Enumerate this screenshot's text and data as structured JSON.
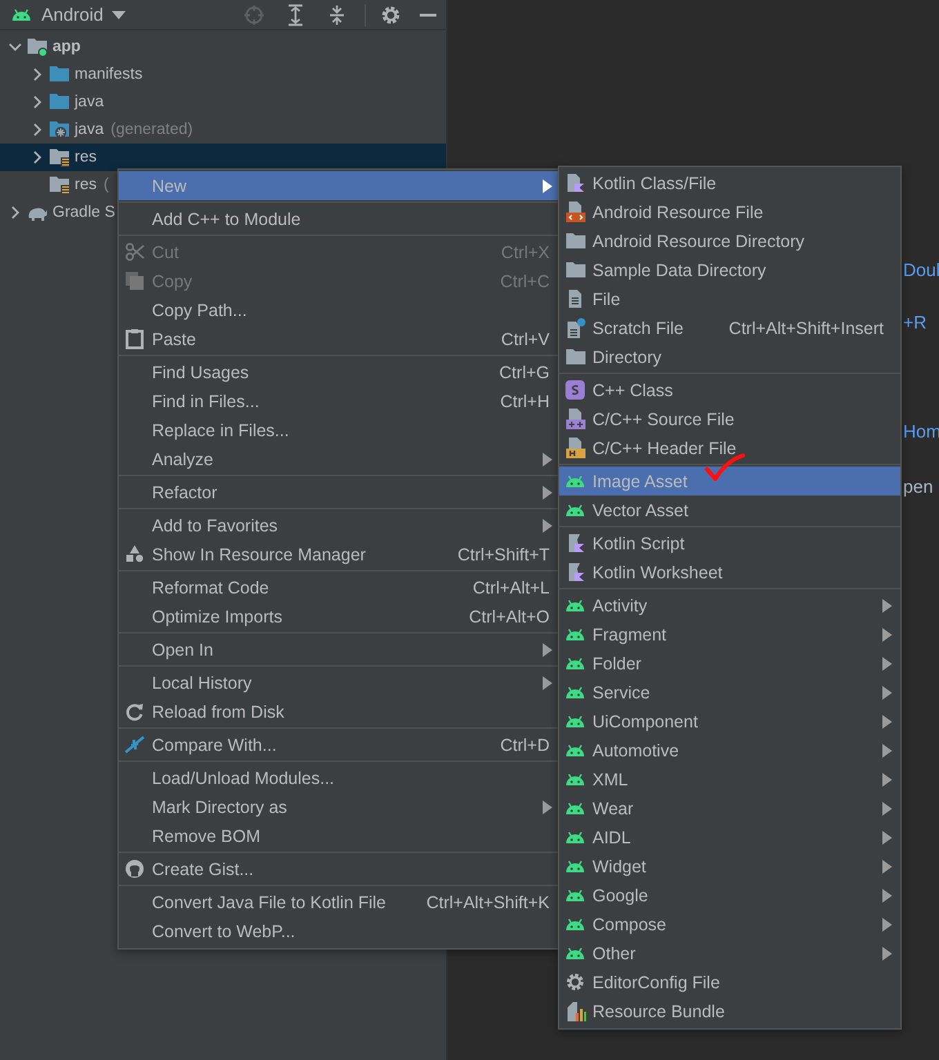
{
  "tool_window": {
    "title": "Android"
  },
  "tree": [
    {
      "label": "app",
      "kind": "module",
      "expanded": true,
      "selected": false,
      "children": [
        {
          "label": "manifests",
          "kind": "folder",
          "expanded": false,
          "selected": false
        },
        {
          "label": "java",
          "kind": "folder",
          "expanded": false,
          "selected": false
        },
        {
          "label": "java",
          "suffix": "(generated)",
          "kind": "generated",
          "expanded": false,
          "selected": false
        },
        {
          "label": "res",
          "kind": "resources",
          "expanded": false,
          "selected": true
        },
        {
          "label": "res",
          "suffix": "(",
          "kind": "resources",
          "selected": false
        }
      ]
    },
    {
      "label": "Gradle S",
      "kind": "gradle",
      "expanded": false,
      "selected": false
    }
  ],
  "editor": {
    "fragments": [
      {
        "text": "Doul",
        "kind": "link"
      },
      {
        "text": "+R",
        "kind": "link"
      },
      {
        "text": "Hom",
        "kind": "link"
      },
      {
        "text": "pen",
        "kind": "text"
      }
    ]
  },
  "context_menu": {
    "groups": [
      [
        {
          "label": "New",
          "kind": "plain",
          "submenu": true,
          "disabled": false,
          "selected": true
        }
      ],
      [
        {
          "label": "Add C++ to Module",
          "kind": "plain",
          "submenu": false,
          "disabled": false,
          "selected": false
        }
      ],
      [
        {
          "label": "Cut",
          "shortcut": "Ctrl+X",
          "kind": "scissors",
          "submenu": false,
          "disabled": true,
          "selected": false
        },
        {
          "label": "Copy",
          "shortcut": "Ctrl+C",
          "kind": "copy",
          "submenu": false,
          "disabled": true,
          "selected": false
        },
        {
          "label": "Copy Path...",
          "kind": "plain",
          "submenu": false,
          "disabled": false,
          "selected": false
        },
        {
          "label": "Paste",
          "shortcut": "Ctrl+V",
          "kind": "clipboard",
          "submenu": false,
          "disabled": false,
          "selected": false
        }
      ],
      [
        {
          "label": "Find Usages",
          "shortcut": "Ctrl+G",
          "kind": "plain",
          "submenu": false,
          "disabled": false,
          "selected": false
        },
        {
          "label": "Find in Files...",
          "shortcut": "Ctrl+H",
          "kind": "plain",
          "submenu": false,
          "disabled": false,
          "selected": false
        },
        {
          "label": "Replace in Files...",
          "kind": "plain",
          "submenu": false,
          "disabled": false,
          "selected": false
        },
        {
          "label": "Analyze",
          "kind": "plain",
          "submenu": true,
          "disabled": false,
          "selected": false
        }
      ],
      [
        {
          "label": "Refactor",
          "kind": "plain",
          "submenu": true,
          "disabled": false,
          "selected": false
        }
      ],
      [
        {
          "label": "Add to Favorites",
          "kind": "plain",
          "submenu": true,
          "disabled": false,
          "selected": false
        },
        {
          "label": "Show In Resource Manager",
          "shortcut": "Ctrl+Shift+T",
          "kind": "shapes",
          "submenu": false,
          "disabled": false,
          "selected": false
        }
      ],
      [
        {
          "label": "Reformat Code",
          "shortcut": "Ctrl+Alt+L",
          "kind": "plain",
          "submenu": false,
          "disabled": false,
          "selected": false
        },
        {
          "label": "Optimize Imports",
          "shortcut": "Ctrl+Alt+O",
          "kind": "plain",
          "submenu": false,
          "disabled": false,
          "selected": false
        }
      ],
      [
        {
          "label": "Open In",
          "kind": "plain",
          "submenu": true,
          "disabled": false,
          "selected": false
        }
      ],
      [
        {
          "label": "Local History",
          "kind": "plain",
          "submenu": true,
          "disabled": false,
          "selected": false
        },
        {
          "label": "Reload from Disk",
          "kind": "reload",
          "submenu": false,
          "disabled": false,
          "selected": false
        }
      ],
      [
        {
          "label": "Compare With...",
          "shortcut": "Ctrl+D",
          "kind": "compare",
          "submenu": false,
          "disabled": false,
          "selected": false
        }
      ],
      [
        {
          "label": "Load/Unload Modules...",
          "kind": "plain",
          "submenu": false,
          "disabled": false,
          "selected": false
        },
        {
          "label": "Mark Directory as",
          "kind": "plain",
          "submenu": true,
          "disabled": false,
          "selected": false
        },
        {
          "label": "Remove BOM",
          "kind": "plain",
          "submenu": false,
          "disabled": false,
          "selected": false
        }
      ],
      [
        {
          "label": "Create Gist...",
          "kind": "github",
          "submenu": false,
          "disabled": false,
          "selected": false
        }
      ],
      [
        {
          "label": "Convert Java File to Kotlin File",
          "shortcut": "Ctrl+Alt+Shift+K",
          "kind": "plain",
          "submenu": false,
          "disabled": false,
          "selected": false
        },
        {
          "label": "Convert to WebP...",
          "kind": "plain",
          "submenu": false,
          "disabled": false,
          "selected": false
        }
      ]
    ]
  },
  "new_submenu": {
    "groups": [
      [
        {
          "label": "Kotlin Class/File",
          "kind": "kotlin",
          "submenu": false,
          "selected": false
        },
        {
          "label": "Android Resource File",
          "kind": "resource",
          "submenu": false,
          "selected": false
        },
        {
          "label": "Android Resource Directory",
          "kind": "folder",
          "submenu": false,
          "selected": false
        },
        {
          "label": "Sample Data Directory",
          "kind": "folder",
          "submenu": false,
          "selected": false
        },
        {
          "label": "File",
          "kind": "file",
          "submenu": false,
          "selected": false
        },
        {
          "label": "Scratch File",
          "shortcut": "Ctrl+Alt+Shift+Insert",
          "kind": "scratch",
          "submenu": false,
          "selected": false
        },
        {
          "label": "Directory",
          "kind": "folder",
          "submenu": false,
          "selected": false
        }
      ],
      [
        {
          "label": "C++ Class",
          "kind": "cppclass",
          "submenu": false,
          "selected": false
        },
        {
          "label": "C/C++ Source File",
          "kind": "cppsource",
          "submenu": false,
          "selected": false
        },
        {
          "label": "C/C++ Header File",
          "kind": "cppheader",
          "submenu": false,
          "selected": false
        }
      ],
      [
        {
          "label": "Image Asset",
          "kind": "android",
          "submenu": false,
          "selected": true
        },
        {
          "label": "Vector Asset",
          "kind": "android",
          "submenu": false,
          "selected": false
        }
      ],
      [
        {
          "label": "Kotlin Script",
          "kind": "script",
          "submenu": false,
          "selected": false
        },
        {
          "label": "Kotlin Worksheet",
          "kind": "script",
          "submenu": false,
          "selected": false
        }
      ],
      [
        {
          "label": "Activity",
          "kind": "android",
          "submenu": true,
          "selected": false
        },
        {
          "label": "Fragment",
          "kind": "android",
          "submenu": true,
          "selected": false
        },
        {
          "label": "Folder",
          "kind": "android",
          "submenu": true,
          "selected": false
        },
        {
          "label": "Service",
          "kind": "android",
          "submenu": true,
          "selected": false
        },
        {
          "label": "UiComponent",
          "kind": "android",
          "submenu": true,
          "selected": false
        },
        {
          "label": "Automotive",
          "kind": "android",
          "submenu": true,
          "selected": false
        },
        {
          "label": "XML",
          "kind": "android",
          "submenu": true,
          "selected": false
        },
        {
          "label": "Wear",
          "kind": "android",
          "submenu": true,
          "selected": false
        },
        {
          "label": "AIDL",
          "kind": "android",
          "submenu": true,
          "selected": false
        },
        {
          "label": "Widget",
          "kind": "android",
          "submenu": true,
          "selected": false
        },
        {
          "label": "Google",
          "kind": "android",
          "submenu": true,
          "selected": false
        },
        {
          "label": "Compose",
          "kind": "android",
          "submenu": true,
          "selected": false
        },
        {
          "label": "Other",
          "kind": "android",
          "submenu": true,
          "selected": false
        },
        {
          "label": "EditorConfig File",
          "kind": "gear",
          "submenu": false,
          "selected": false
        },
        {
          "label": "Resource Bundle",
          "kind": "bundle",
          "submenu": false,
          "selected": false
        }
      ]
    ]
  }
}
